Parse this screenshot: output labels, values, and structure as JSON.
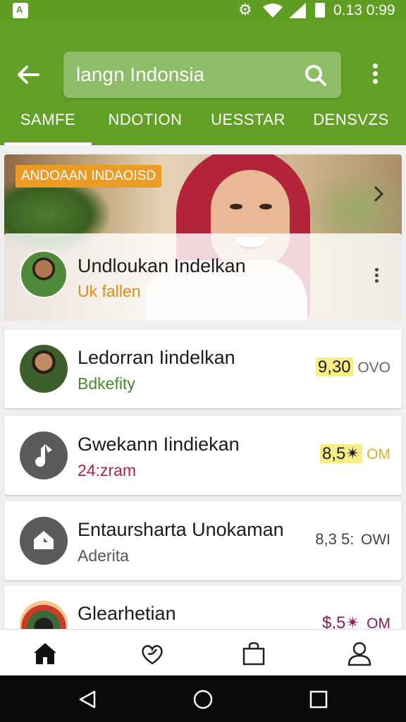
{
  "status_bar": {
    "time": "0.13 0:99",
    "icons": [
      "app-notification-icon",
      "settings-icon",
      "wifi-icon",
      "signal-icon",
      "battery-icon"
    ]
  },
  "app_bar": {
    "search_value": "langn Indonsia",
    "icons": [
      "back-arrow-icon",
      "search-icon",
      "more-vert-icon"
    ]
  },
  "tabs": [
    {
      "label": "SAMFE",
      "active": true
    },
    {
      "label": "NDOTION",
      "active": false
    },
    {
      "label": "UESSTAR",
      "active": false
    },
    {
      "label": "DENSVZS",
      "active": false
    }
  ],
  "featured": {
    "tag": "ANDOAAN INDAOISD",
    "title": "Undloukan Indelkan",
    "subtitle": "Uk fallen",
    "subtitle_color": "#e08a1a"
  },
  "list": [
    {
      "title": "Ledorran Iindelkan",
      "subtitle": "Bdkefity",
      "subtitle_color": "#3f8f26",
      "rating_value": "9,30",
      "rating_suffix": "OVO",
      "rating_value_color": "#1c1c1c",
      "rating_suffix_color": "#666666",
      "highlight": "#f7ef86",
      "avatar": "person-photo"
    },
    {
      "title": "Gwekann Iindiekan",
      "subtitle": "24:zram",
      "subtitle_color": "#b0213f",
      "rating_value": "8,5✴",
      "rating_suffix": "OM",
      "rating_value_color": "#1c1c1c",
      "rating_suffix_color": "#d1b52a",
      "highlight": "#f7ef86",
      "avatar": "music-note-icon"
    },
    {
      "title": "Entaursharta Unokaman",
      "subtitle": "Aderita",
      "subtitle_color": "#555555",
      "rating_value": "8,3 5:",
      "rating_suffix": "OWI",
      "rating_value_color": "#444444",
      "rating_suffix_color": "#444444",
      "highlight": "transparent",
      "avatar": "tag-icon"
    },
    {
      "title": "Glearhetian",
      "subtitle": "",
      "subtitle_color": "#555555",
      "rating_value": "$,5✴",
      "rating_suffix": "OM",
      "rating_value_color": "#8a1a5a",
      "rating_suffix_color": "#8a1a5a",
      "highlight": "transparent",
      "avatar": "person-photo"
    }
  ],
  "bottom_nav": [
    "home-icon",
    "favorites-icon",
    "shopping-bag-icon",
    "profile-icon"
  ],
  "system_nav": [
    "back-icon",
    "home-circle-icon",
    "recents-icon"
  ],
  "colors": {
    "primary": "#62a026",
    "search_fill": "#8ebd68",
    "tag_orange": "#ec9c24"
  }
}
